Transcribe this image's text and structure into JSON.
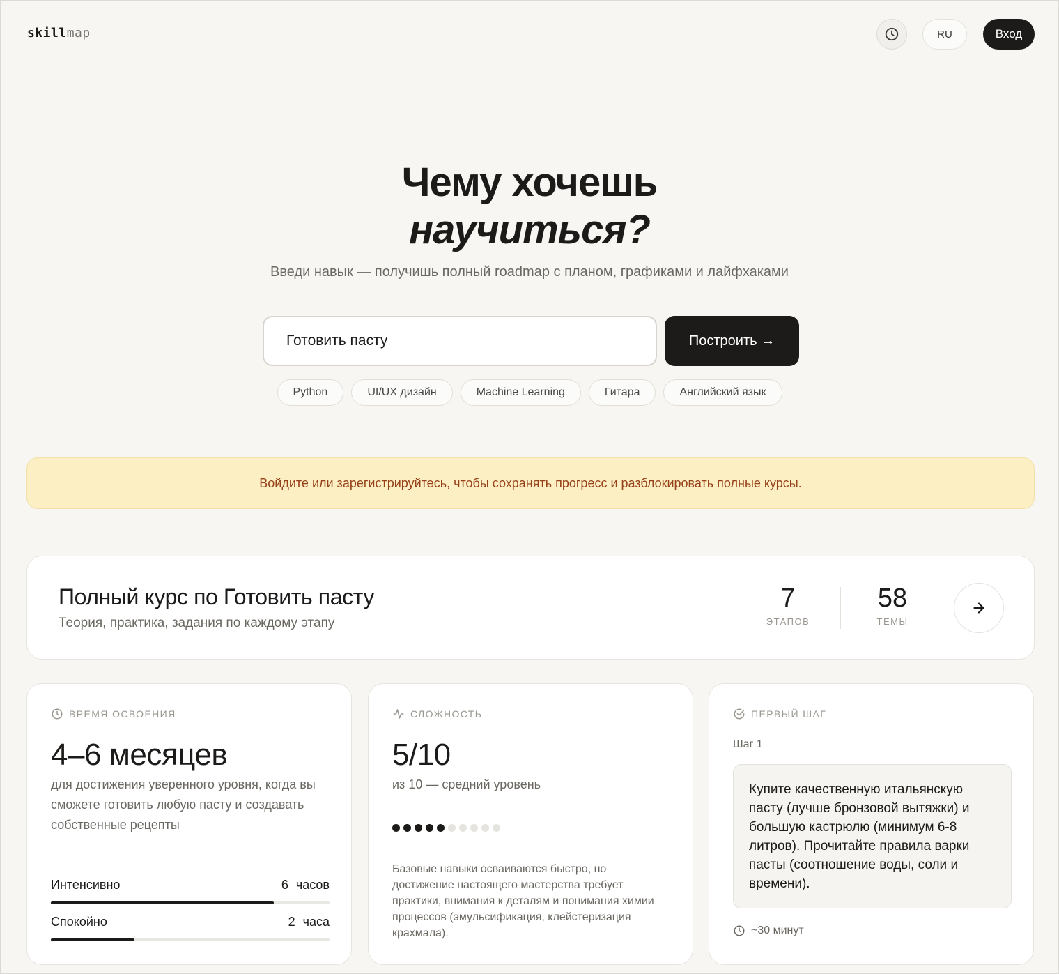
{
  "header": {
    "logo_bold": "skill",
    "logo_light": "map",
    "lang": "RU",
    "login": "Вход"
  },
  "hero": {
    "title_line1": "Чему хочешь",
    "title_line2": "научиться?",
    "subtitle": "Введи навык — получишь полный roadmap с планом, графиками и лайфхаками",
    "input_value": "Готовить пасту",
    "build_button": "Построить →",
    "chips": [
      "Python",
      "UI/UX дизайн",
      "Machine Learning",
      "Гитара",
      "Английский язык"
    ]
  },
  "banner": {
    "text": "Войдите или зарегистрируйтесь, чтобы сохранять прогресс и разблокировать полные курсы."
  },
  "course": {
    "title": "Полный курс по Готовить пасту",
    "subtitle": "Теория, практика, задания по каждому этапу",
    "stages_value": "7",
    "stages_label": "этапов",
    "topics_value": "58",
    "topics_label": "темы"
  },
  "time_card": {
    "heading": "Время освоения",
    "value": "4–6 месяцев",
    "description": "для достижения уверенного уровня, когда вы сможете готовить любую пасту и создавать собственные рецепты",
    "rows": [
      {
        "label": "Интенсивно",
        "value": "6 часов",
        "progress": 0.8
      },
      {
        "label": "Спокойно",
        "value": "2 часа",
        "progress": 0.3
      }
    ]
  },
  "difficulty_card": {
    "heading": "Сложность",
    "value": "5/10",
    "caption": "из 10 — средний уровень",
    "level": 5,
    "max": 10,
    "description": "Базовые навыки осваиваются быстро, но достижение настоящего мастерства требует практики, внимания к деталям и понимания химии процессов (эмульсификация, клейстеризация крахмала)."
  },
  "first_step_card": {
    "heading": "Первый шаг",
    "step_label": "Шаг 1",
    "text": "Купите качественную итальянскую пасту (лучше бронзовой вытяжки) и большую кастрюлю (минимум 6-8 литров). Прочитайте правила варки пасты (соотношение воды, соли и времени).",
    "duration": "~30 минут"
  },
  "colors": {
    "background": "#f7f6f2",
    "accent_dark": "#1c1b19",
    "banner_bg": "#fcefc4",
    "banner_text": "#97411a"
  },
  "icons": [
    "clock-icon",
    "arrow-right-icon",
    "activity-icon",
    "check-circle-icon"
  ]
}
